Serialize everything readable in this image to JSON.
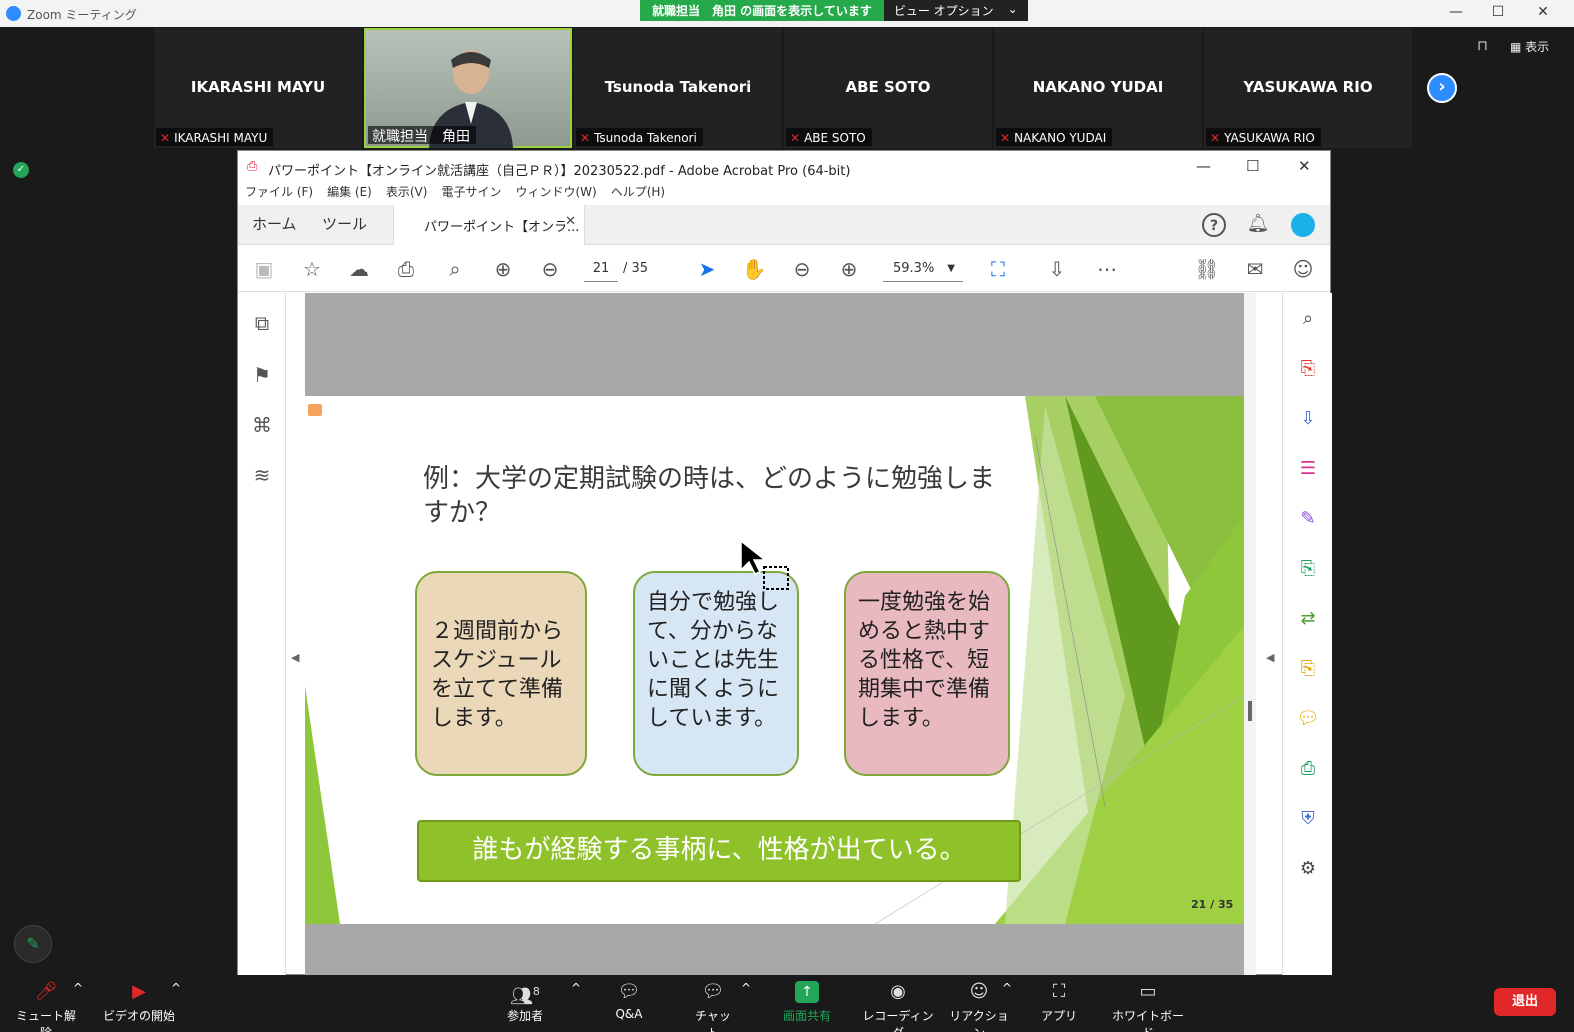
{
  "zoom": {
    "window_title": "Zoom ミーティング",
    "share_banner": "就職担当　角田 の画面を表示しています",
    "view_options": "ビュー オプション",
    "view_toggle": "表示",
    "participants": [
      {
        "big": "IKARASHI MAYU",
        "small": "IKARASHI MAYU",
        "muted": true
      },
      {
        "big": "",
        "small": "就職担当　角田",
        "muted": false,
        "video": true
      },
      {
        "big": "Tsunoda Takenori",
        "small": "Tsunoda Takenori",
        "muted": true
      },
      {
        "big": "ABE SOTO",
        "small": "ABE SOTO",
        "muted": true
      },
      {
        "big": "NAKANO YUDAI",
        "small": "NAKANO YUDAI",
        "muted": true
      },
      {
        "big": "YASUKAWA RIO",
        "small": "YASUKAWA RIO",
        "muted": true
      }
    ],
    "controls": {
      "unmute": "ミュート解除",
      "start_video": "ビデオの開始",
      "participants": "参加者",
      "participants_count": "8",
      "qa": "Q&A",
      "chat": "チャット",
      "share": "画面共有",
      "recording": "レコーディング",
      "reaction": "リアクション",
      "apps": "アプリ",
      "whiteboard": "ホワイトボード",
      "leave": "退出"
    }
  },
  "acrobat": {
    "title": "パワーポイント【オンライン就活講座（自己ＰＲ）】20230522.pdf - Adobe Acrobat Pro (64-bit)",
    "menu": [
      "ファイル (F)",
      "編集 (E)",
      "表示(V)",
      "電子サイン",
      "ウィンドウ(W)",
      "ヘルプ(H)"
    ],
    "tabs": {
      "home": "ホーム",
      "tools": "ツール",
      "doc": "パワーポイント【オンラ..."
    },
    "page_current": "21",
    "page_total": "/ 35",
    "zoom": "59.3%"
  },
  "slide": {
    "question": "例：大学の定期試験の時は、どのように勉強しますか？",
    "card1": "２週間前からスケジュールを立てて準備します。",
    "card2": "自分で勉強して、分からないことは先生に聞くようにしています。",
    "card3": "一度勉強を始めると熱中する性格で、短期集中で準備します。",
    "banner": "誰もが経験する事柄に、性格が出ている。",
    "page_label": "21 / 35"
  }
}
